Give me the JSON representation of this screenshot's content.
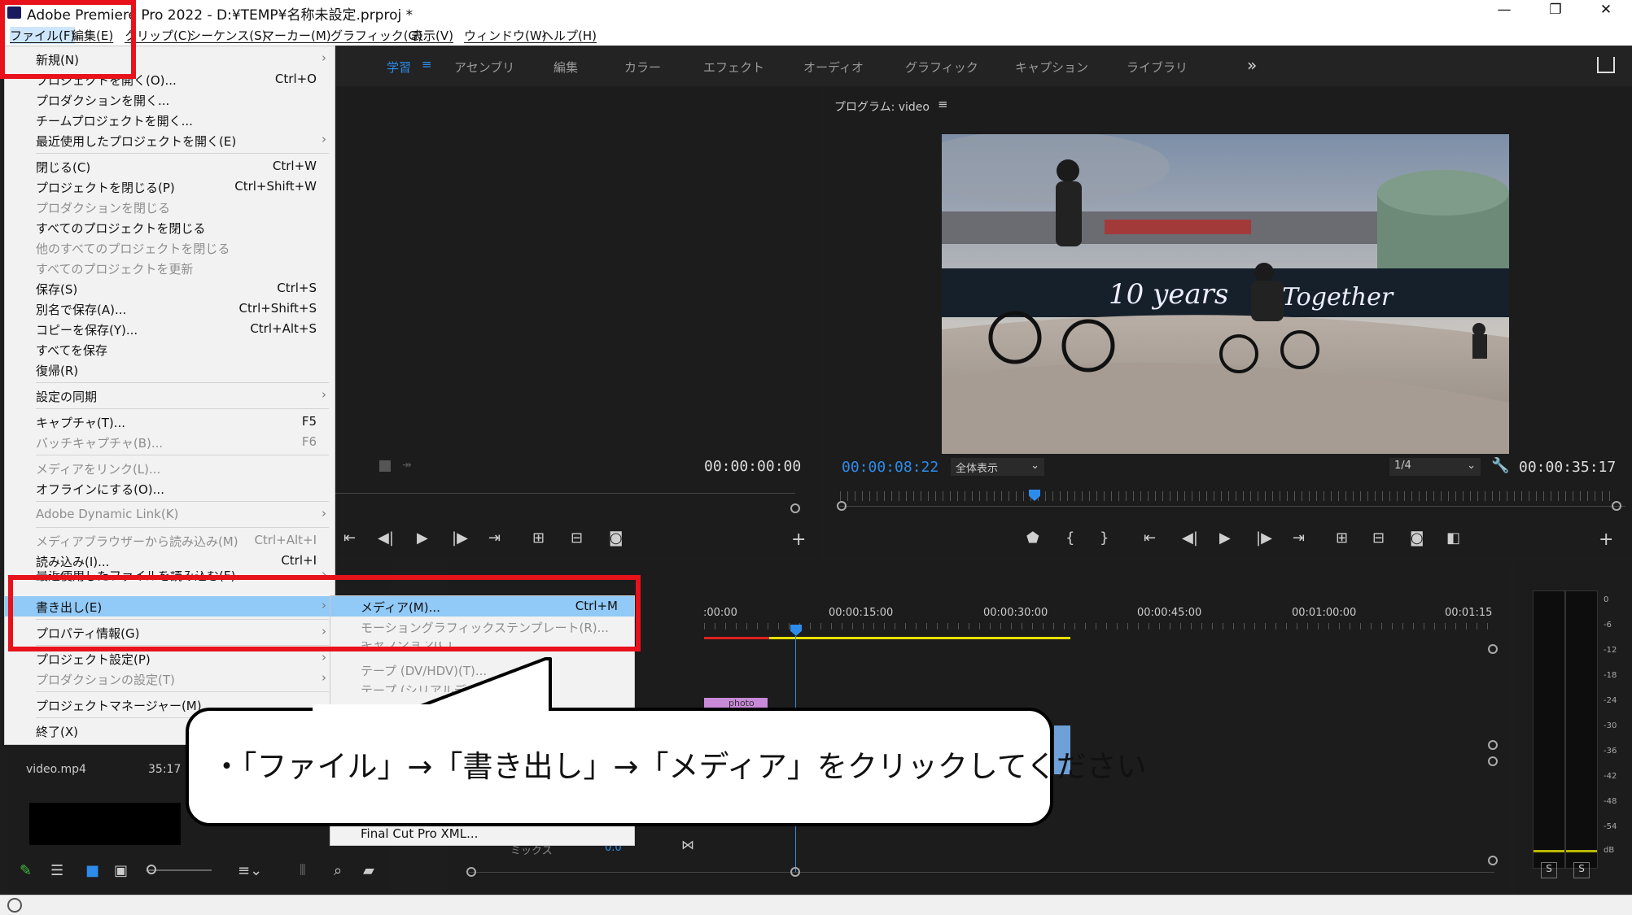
{
  "titlebar": {
    "title": "Adobe Premiere Pro 2022 - D:¥TEMP¥名称未設定.prproj *",
    "minimize": "—",
    "maximize": "❐",
    "close": "✕"
  },
  "menubar": [
    "ファイル(F)",
    "編集(E)",
    "クリップ(C)",
    "シーケンス(S)",
    "マーカー(M)",
    "グラフィック(G)",
    "表示(V)",
    "ウィンドウ(W)",
    "ヘルプ(H)"
  ],
  "workspaces": [
    "学習",
    "アセンブリ",
    "編集",
    "カラー",
    "エフェクト",
    "オーディオ",
    "グラフィック",
    "キャプション",
    "ライブラリ"
  ],
  "source": {
    "timecode": "00:00:00:00"
  },
  "program": {
    "title": "プログラム: video",
    "timecode": "00:00:08:22",
    "zoom": "全体表示",
    "resolution": "1/4",
    "duration": "00:00:35:17"
  },
  "file_menu": {
    "items": [
      {
        "label": "新規(N)",
        "shortcut": "",
        "submenu": true,
        "disabled": false
      },
      {
        "label": "プロジェクトを開く(O)...",
        "shortcut": "Ctrl+O",
        "submenu": false,
        "disabled": false
      },
      {
        "label": "プロダクションを開く...",
        "shortcut": "",
        "submenu": false,
        "disabled": false
      },
      {
        "label": "チームプロジェクトを開く...",
        "shortcut": "",
        "submenu": false,
        "disabled": false
      },
      {
        "label": "最近使用したプロジェクトを開く(E)",
        "shortcut": "",
        "submenu": true,
        "disabled": false
      },
      {
        "label": "閉じる(C)",
        "shortcut": "Ctrl+W",
        "submenu": false,
        "disabled": false
      },
      {
        "label": "プロジェクトを閉じる(P)",
        "shortcut": "Ctrl+Shift+W",
        "submenu": false,
        "disabled": false
      },
      {
        "label": "プロダクションを閉じる",
        "shortcut": "",
        "submenu": false,
        "disabled": true
      },
      {
        "label": "すべてのプロジェクトを閉じる",
        "shortcut": "",
        "submenu": false,
        "disabled": false
      },
      {
        "label": "他のすべてのプロジェクトを閉じる",
        "shortcut": "",
        "submenu": false,
        "disabled": true
      },
      {
        "label": "すべてのプロジェクトを更新",
        "shortcut": "",
        "submenu": false,
        "disabled": true
      },
      {
        "label": "保存(S)",
        "shortcut": "Ctrl+S",
        "submenu": false,
        "disabled": false
      },
      {
        "label": "別名で保存(A)...",
        "shortcut": "Ctrl+Shift+S",
        "submenu": false,
        "disabled": false
      },
      {
        "label": "コピーを保存(Y)...",
        "shortcut": "Ctrl+Alt+S",
        "submenu": false,
        "disabled": false
      },
      {
        "label": "すべてを保存",
        "shortcut": "",
        "submenu": false,
        "disabled": false
      },
      {
        "label": "復帰(R)",
        "shortcut": "",
        "submenu": false,
        "disabled": false
      },
      {
        "label": "設定の同期",
        "shortcut": "",
        "submenu": true,
        "disabled": false
      },
      {
        "label": "キャプチャ(T)...",
        "shortcut": "F5",
        "submenu": false,
        "disabled": false
      },
      {
        "label": "バッチキャプチャ(B)...",
        "shortcut": "F6",
        "submenu": false,
        "disabled": true
      },
      {
        "label": "メディアをリンク(L)...",
        "shortcut": "",
        "submenu": false,
        "disabled": true
      },
      {
        "label": "オフラインにする(O)...",
        "shortcut": "",
        "submenu": false,
        "disabled": false
      },
      {
        "label": "Adobe Dynamic Link(K)",
        "shortcut": "",
        "submenu": true,
        "disabled": true
      },
      {
        "label": "メディアブラウザーから読み込み(M)",
        "shortcut": "Ctrl+Alt+I",
        "submenu": false,
        "disabled": true
      },
      {
        "label": "読み込み(I)...",
        "shortcut": "Ctrl+I",
        "submenu": false,
        "disabled": false
      },
      {
        "label": "最近使用したファイルを読み込む(F)",
        "shortcut": "",
        "submenu": true,
        "disabled": false
      },
      {
        "label": "書き出し(E)",
        "shortcut": "",
        "submenu": true,
        "disabled": false
      },
      {
        "label": "プロパティ情報(G)",
        "shortcut": "",
        "submenu": true,
        "disabled": false
      },
      {
        "label": "プロジェクト設定(P)",
        "shortcut": "",
        "submenu": true,
        "disabled": false
      },
      {
        "label": "プロダクションの設定(T)",
        "shortcut": "",
        "submenu": true,
        "disabled": true
      },
      {
        "label": "プロジェクトマネージャー(M)...",
        "shortcut": "",
        "submenu": false,
        "disabled": false
      },
      {
        "label": "終了(X)",
        "shortcut": "",
        "submenu": false,
        "disabled": false
      }
    ]
  },
  "export_submenu": {
    "items": [
      {
        "label": "メディア(M)...",
        "shortcut": "Ctrl+M",
        "disabled": false
      },
      {
        "label": "モーショングラフィックステンプレート(R)...",
        "shortcut": "",
        "disabled": true
      },
      {
        "label": "キャプション(C)...",
        "shortcut": "",
        "disabled": true
      },
      {
        "label": "テープ (DV/HDV)(T)...",
        "shortcut": "",
        "disabled": true
      },
      {
        "label": "テープ (シリアルデバイス)(S)...",
        "shortcut": "",
        "disabled": true
      },
      {
        "label": "Final Cut Pro XML...",
        "shortcut": "",
        "disabled": false
      }
    ]
  },
  "timeline": {
    "ruler": [
      ":00:00",
      "00:00:15:00",
      "00:00:30:00",
      "00:00:45:00",
      "00:01:00:00",
      "00:01:15"
    ],
    "mix_label": "ミックス",
    "mix_value": "0.0",
    "clip_label": "photo"
  },
  "meter": {
    "scale": [
      "0",
      "-6",
      "-12",
      "-18",
      "-24",
      "-30",
      "-36",
      "-42",
      "-48",
      "-54",
      "dB"
    ],
    "solo": [
      "S",
      "S"
    ]
  },
  "project": {
    "clip_name": "video.mp4",
    "clip_duration": "35:17"
  },
  "callout": {
    "text": "・「ファイル」→「書き出し」→「メディア」をクリックしてください"
  },
  "colors": {
    "highlight": "#91c9f7",
    "redbox": "#e8121b",
    "timecode_blue": "#2d8ceb"
  }
}
